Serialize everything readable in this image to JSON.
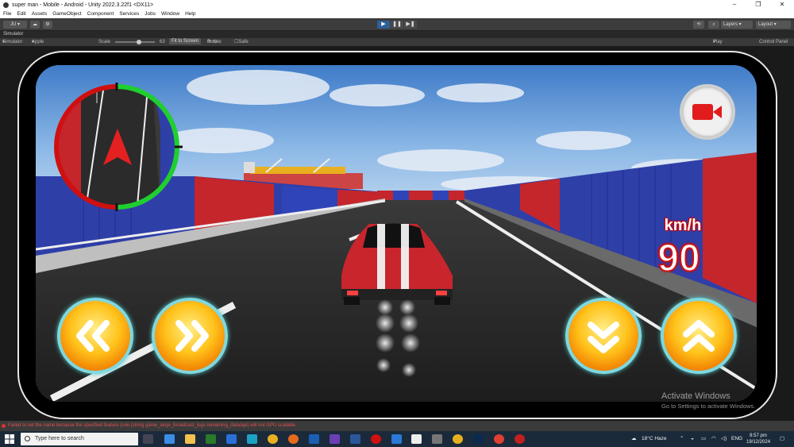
{
  "window": {
    "title": "super man - Mobile - Android - Unity 2022.3.22f1 <DX11>",
    "controls": [
      "–",
      "❐",
      "✕"
    ]
  },
  "menu": [
    "File",
    "Edit",
    "Assets",
    "GameObject",
    "Component",
    "Services",
    "Jobs",
    "Window",
    "Help"
  ],
  "toolbar": {
    "account": "JU",
    "cloud_icon": "cloud-icon",
    "play": "▶",
    "pause": "❚❚",
    "step": "▶❚",
    "layers": "Layers",
    "layout": "Layout"
  },
  "simulator": {
    "tab_label": "Simulator",
    "mode": "Simulator",
    "device": "Apple iPhone 12 Pro Max",
    "scale_label": "Scale",
    "scale_value": "63",
    "fit_to_screen": "Fit to Screen",
    "rotate": "Rotate",
    "safe_area": "Safe Area",
    "play_mode": "Play Unfocused",
    "control_panel": "Control Panel",
    "scale_fraction": 0.6
  },
  "game": {
    "speed_unit": "km/h",
    "speed_value": "90",
    "colors": {
      "hud_red": "#d01010",
      "button_orange": "#f7a000",
      "button_ring": "#7fd8df",
      "minimap_green": "#1fcf2f",
      "car_red": "#c8252d"
    },
    "buttons": {
      "left": "left-arrow-icon",
      "right": "right-arrow-icon",
      "brake": "down-arrow-icon",
      "accelerate": "up-arrow-icon",
      "record": "video-camera-icon"
    }
  },
  "watermark": {
    "line1": "Activate Windows",
    "line2": "Go to Settings to activate Windows."
  },
  "console": {
    "message": "Failed to set the name because the specified feature (rule (string game_large_broadcast_logs remaining_data/api) will not GPU scalable."
  },
  "taskbar": {
    "search_placeholder": "Type here to search",
    "weather": "18°C  Haze",
    "language": "ENG",
    "time": "8:57 pm",
    "date": "19/12/2024"
  }
}
